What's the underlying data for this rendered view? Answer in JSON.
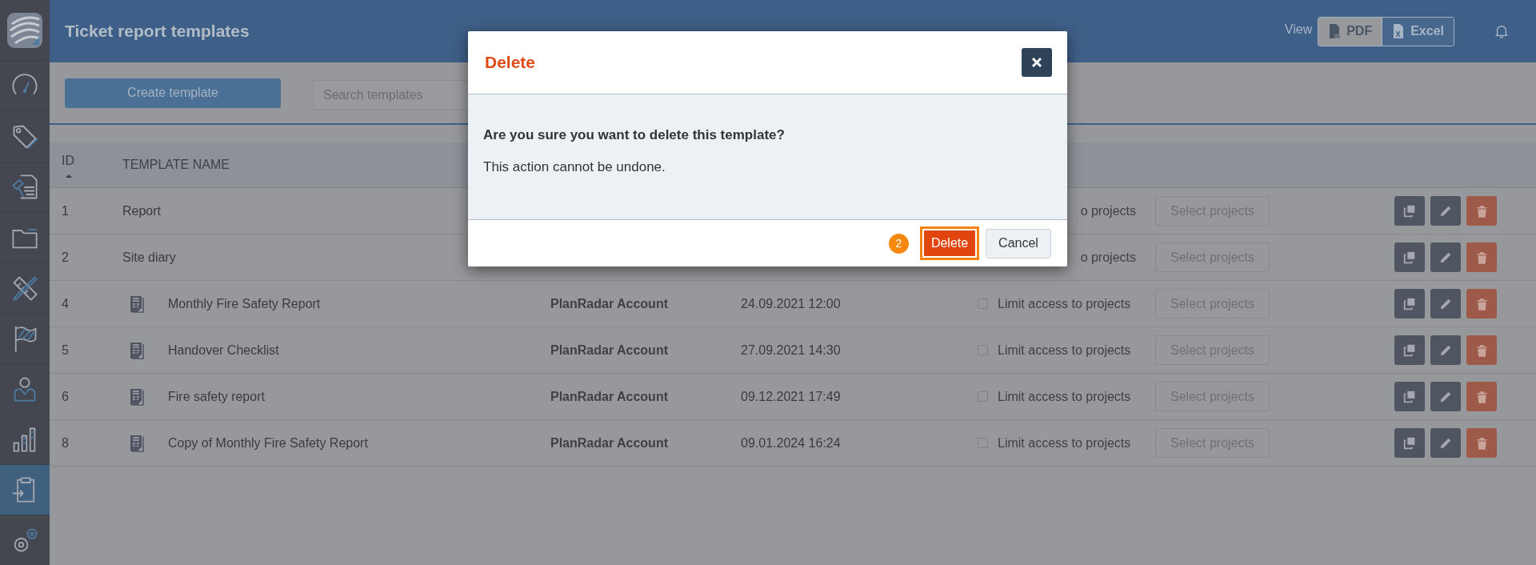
{
  "sidebar": {
    "items": [
      {
        "selected": false
      },
      {
        "selected": false
      },
      {
        "selected": false
      },
      {
        "selected": false
      },
      {
        "selected": false
      },
      {
        "selected": false
      },
      {
        "selected": false
      },
      {
        "selected": false
      },
      {
        "selected": true
      },
      {
        "selected": false
      }
    ]
  },
  "header": {
    "title": "Ticket report templates",
    "view_label": "View",
    "view_options": [
      {
        "label": "PDF"
      },
      {
        "label": "Excel"
      }
    ]
  },
  "toolbar": {
    "create_button": "Create template",
    "search": {
      "placeholder": "Search templates"
    }
  },
  "table": {
    "columns": [
      {
        "label": "ID",
        "sorted": true
      },
      {
        "label": "TEMPLATE NAME"
      }
    ],
    "rows": [
      {
        "id": "1",
        "name": "Report",
        "kind": "plain",
        "limit_label": "o projects",
        "select_button": "Select projects"
      },
      {
        "id": "2",
        "name": "Site diary",
        "kind": "plain",
        "limit_label": "o projects",
        "select_button": "Select projects"
      },
      {
        "id": "4",
        "name": "Monthly Fire Safety Report",
        "kind": "document",
        "owner": "PlanRadar Account",
        "created": "24.09.2021 12:00",
        "limit_checked": false,
        "limit_label": "Limit access to projects",
        "select_button": "Select projects"
      },
      {
        "id": "5",
        "name": "Handover Checklist",
        "kind": "document",
        "owner": "PlanRadar Account",
        "created": "27.09.2021 14:30",
        "limit_checked": false,
        "limit_label": "Limit access to projects",
        "select_button": "Select projects"
      },
      {
        "id": "6",
        "name": "Fire safety report",
        "kind": "document",
        "owner": "PlanRadar Account",
        "created": "09.12.2021 17:49",
        "limit_checked": false,
        "limit_label": "Limit access to projects",
        "select_button": "Select projects"
      },
      {
        "id": "8",
        "name": "Copy of Monthly Fire Safety Report",
        "kind": "document",
        "owner": "PlanRadar Account",
        "created": "09.01.2024 16:24",
        "limit_checked": false,
        "limit_label": "Limit access to projects",
        "select_button": "Select projects"
      }
    ]
  },
  "dialog": {
    "title": "Delete",
    "question": "Are you sure you want to delete this template?",
    "message": "This action cannot be undone.",
    "step_badge": "2",
    "buttons": [
      {
        "label": "Delete",
        "kind": "danger",
        "focused": true
      },
      {
        "label": "Cancel",
        "kind": "default",
        "focused": false
      }
    ]
  }
}
